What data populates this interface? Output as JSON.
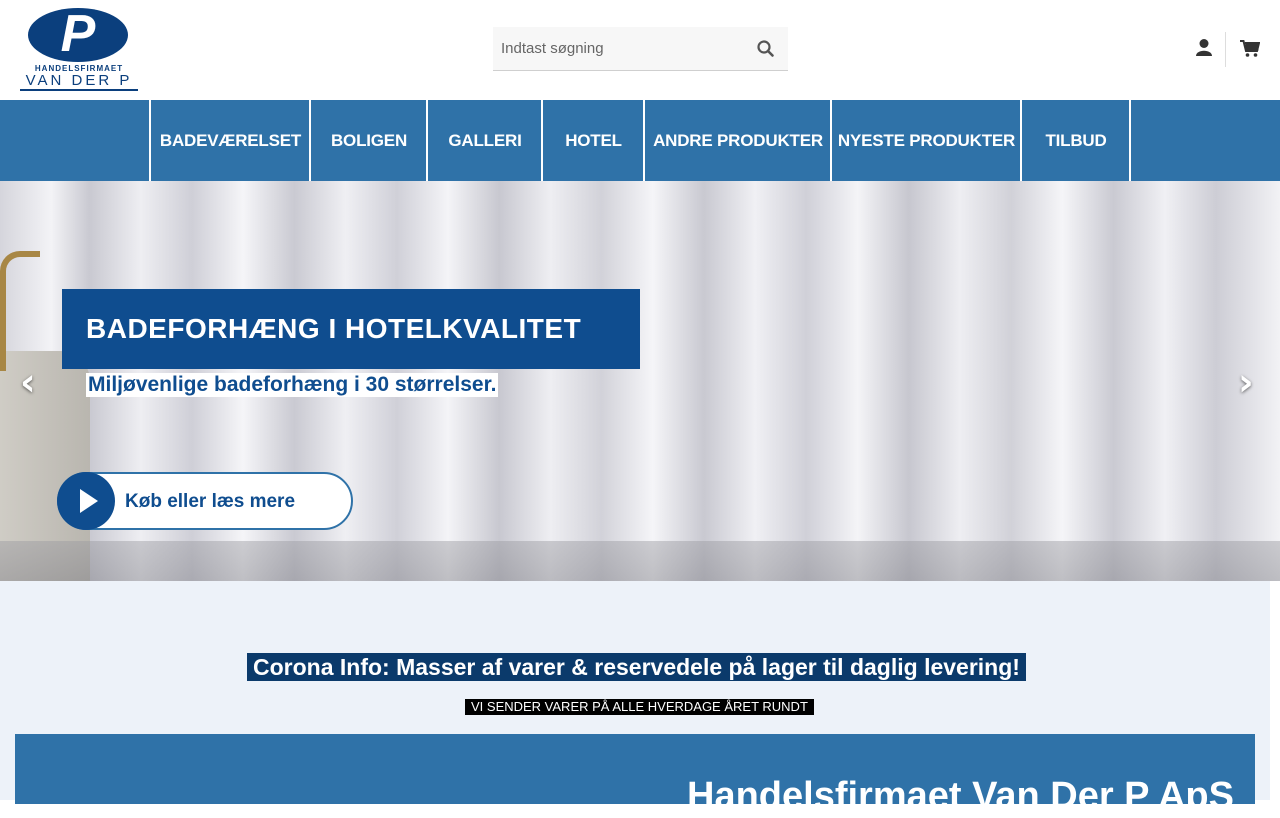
{
  "header": {
    "logo": {
      "top_text": "HANDELSFIRMAET",
      "bottom_text": "VAN DER P",
      "letter": "P"
    },
    "search": {
      "placeholder": "Indtast søgning",
      "icon": "search-icon"
    },
    "account_icon": "user-icon",
    "cart_icon": "shopping-cart-icon"
  },
  "nav": {
    "items": [
      {
        "label": "BADEVÆRELSET"
      },
      {
        "label": "BOLIGEN"
      },
      {
        "label": "GALLERI"
      },
      {
        "label": "HOTEL"
      },
      {
        "label": "ANDRE PRODUKTER"
      },
      {
        "label": "NYESTE PRODUKTER"
      },
      {
        "label": "TILBUD"
      }
    ]
  },
  "slider": {
    "title": "BADEFORHÆNG I HOTELKVALITET",
    "subtitle": "Miljøvenlige badeforhæng i 30 størrelser.",
    "button_label": "Køb eller læs mere",
    "prev_icon": "chevron-left-icon",
    "next_icon": "chevron-right-icon"
  },
  "content": {
    "corona": "Corona Info:  Masser af varer & reservedele på lager til daglig levering!",
    "shipping": "VI SENDER VARER PÅ ALLE HVERDAGE ÅRET RUNDT",
    "company_title": "Handelsfirmaet Van Der P ApS"
  },
  "colors": {
    "nav_blue": "#2f72a8",
    "brand_dark_blue": "#0b3f7d",
    "content_bg": "#edf2f9"
  }
}
